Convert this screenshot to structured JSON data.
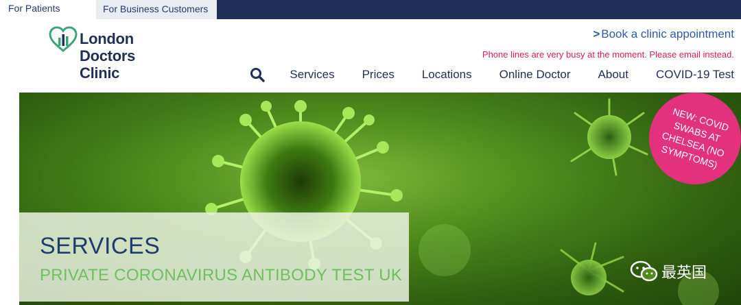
{
  "audience_tabs": [
    {
      "label": "For Patients",
      "active": true
    },
    {
      "label": "For Business Customers",
      "active": false
    }
  ],
  "logo": {
    "lines": [
      "London",
      "Doctors",
      "Clinic"
    ],
    "icon": "heart-chart-logo"
  },
  "header": {
    "book_link": "Book a clinic appointment",
    "book_chevron": ">",
    "phone_note": "Phone lines are very busy at the moment. Please email instead."
  },
  "nav": {
    "search_icon": "search-icon",
    "items": [
      "Services",
      "Prices",
      "Locations",
      "Online Doctor",
      "About",
      "COVID-19 Test"
    ]
  },
  "hero": {
    "title": "SERVICES",
    "subtitle": "PRIVATE CORONAVIRUS ANTIBODY TEST UK",
    "badge": "NEW: COVID SWABS AT CHELSEA (NO SYMPTOMS)"
  },
  "watermark": {
    "text": "最英国",
    "icon": "wechat-icon"
  },
  "colors": {
    "navy": "#1f2f55",
    "link_blue": "#2f5aa5",
    "alert_pink": "#e0195a",
    "badge_pink": "#e3317d",
    "teal_green": "#3aa57a",
    "hero_green": "#4e8a1c",
    "subtitle_green": "#6fbf5c"
  }
}
